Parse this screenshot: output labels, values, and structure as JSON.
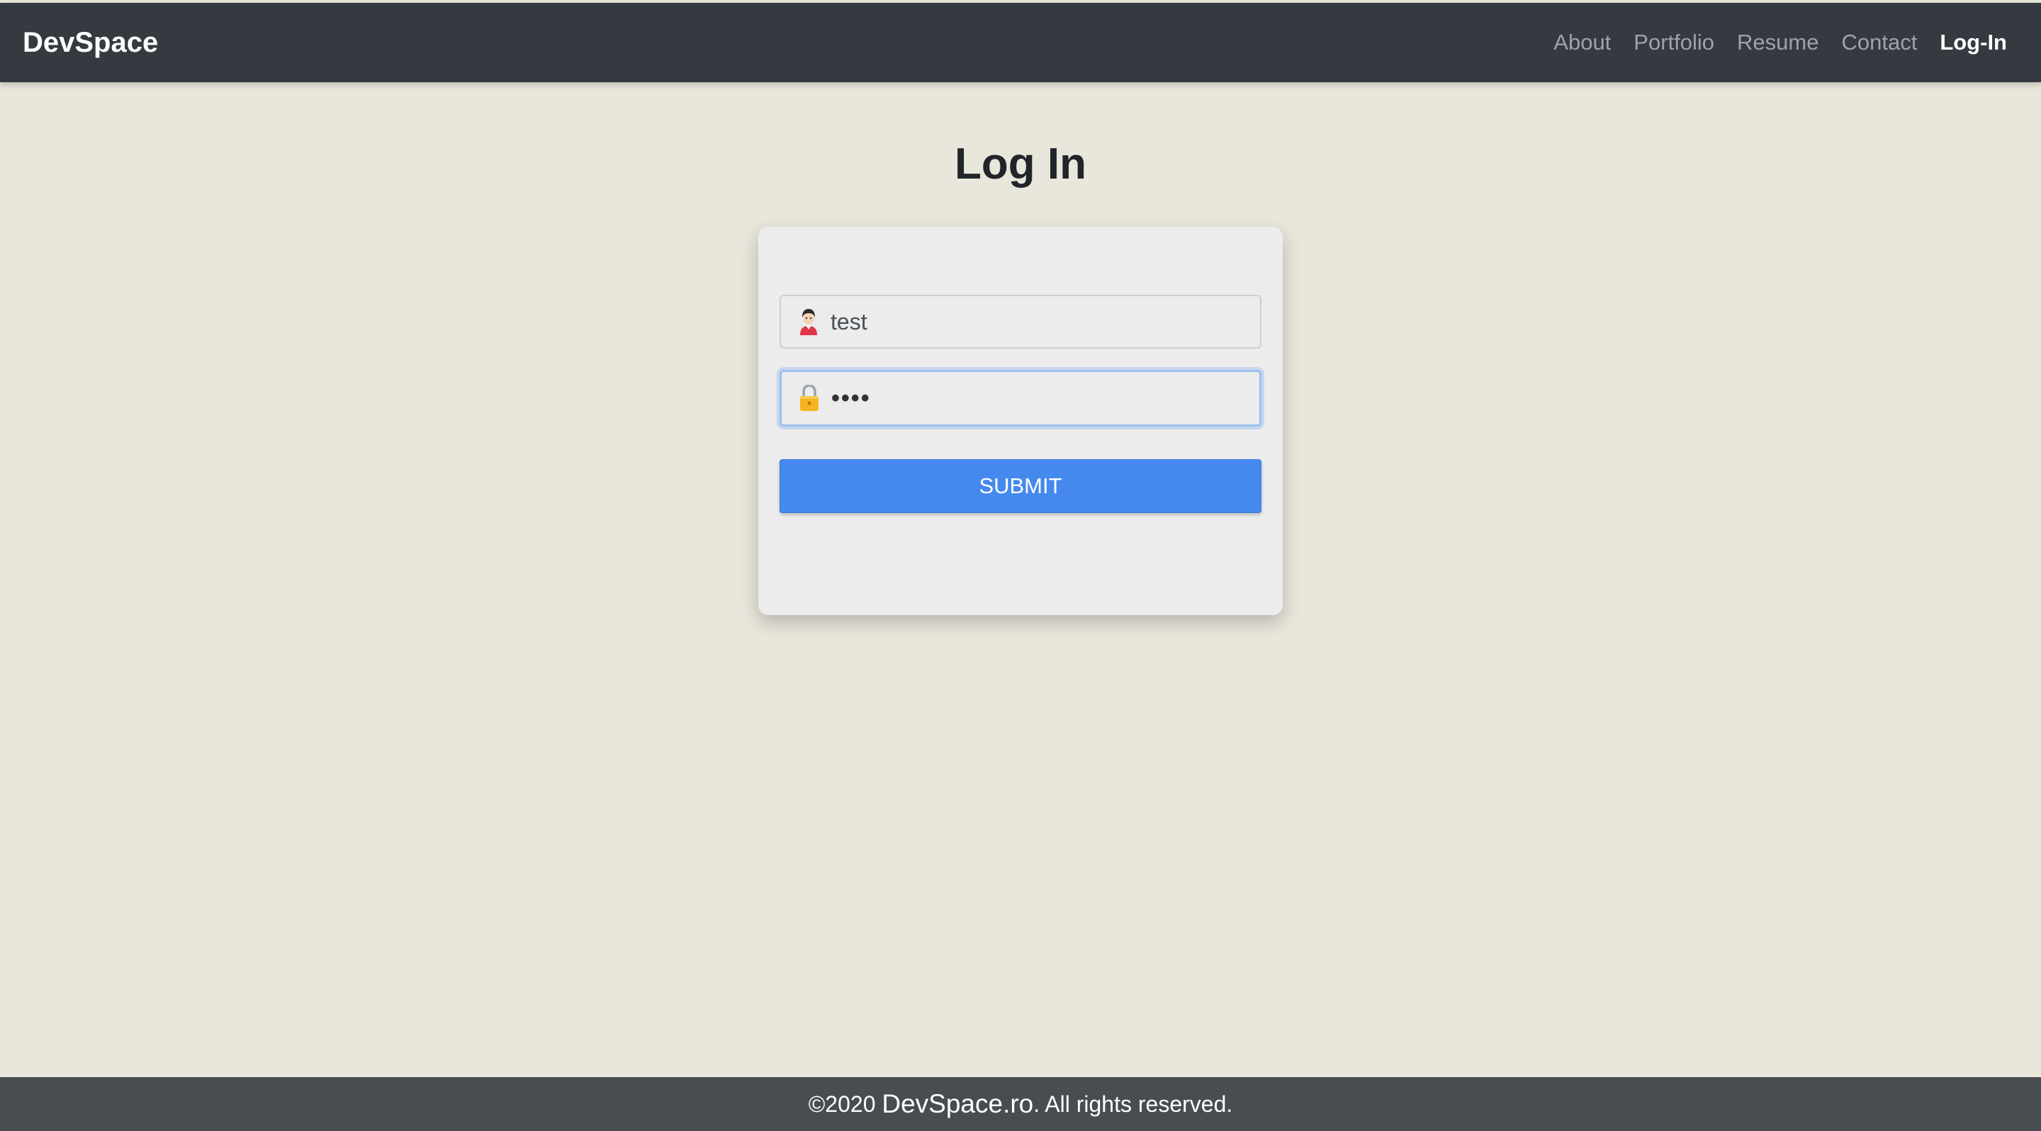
{
  "navbar": {
    "brand": "DevSpace",
    "links": [
      {
        "label": "About"
      },
      {
        "label": "Portfolio"
      },
      {
        "label": "Resume"
      },
      {
        "label": "Contact"
      },
      {
        "label": "Log-In"
      }
    ],
    "active": "Log-In"
  },
  "page": {
    "title": "Log In"
  },
  "form": {
    "username": {
      "value": "test",
      "icon": "user-icon"
    },
    "password": {
      "value": "••••",
      "icon": "lock-icon"
    },
    "submit_label": "SUBMIT"
  },
  "footer": {
    "prefix": "©2020 ",
    "domain": "DevSpace.ro",
    "suffix": ". All rights reserved."
  },
  "colors": {
    "navbar": "#343a40",
    "background": "#e9e6db",
    "button": "#4589ee",
    "footer": "#484d52"
  }
}
